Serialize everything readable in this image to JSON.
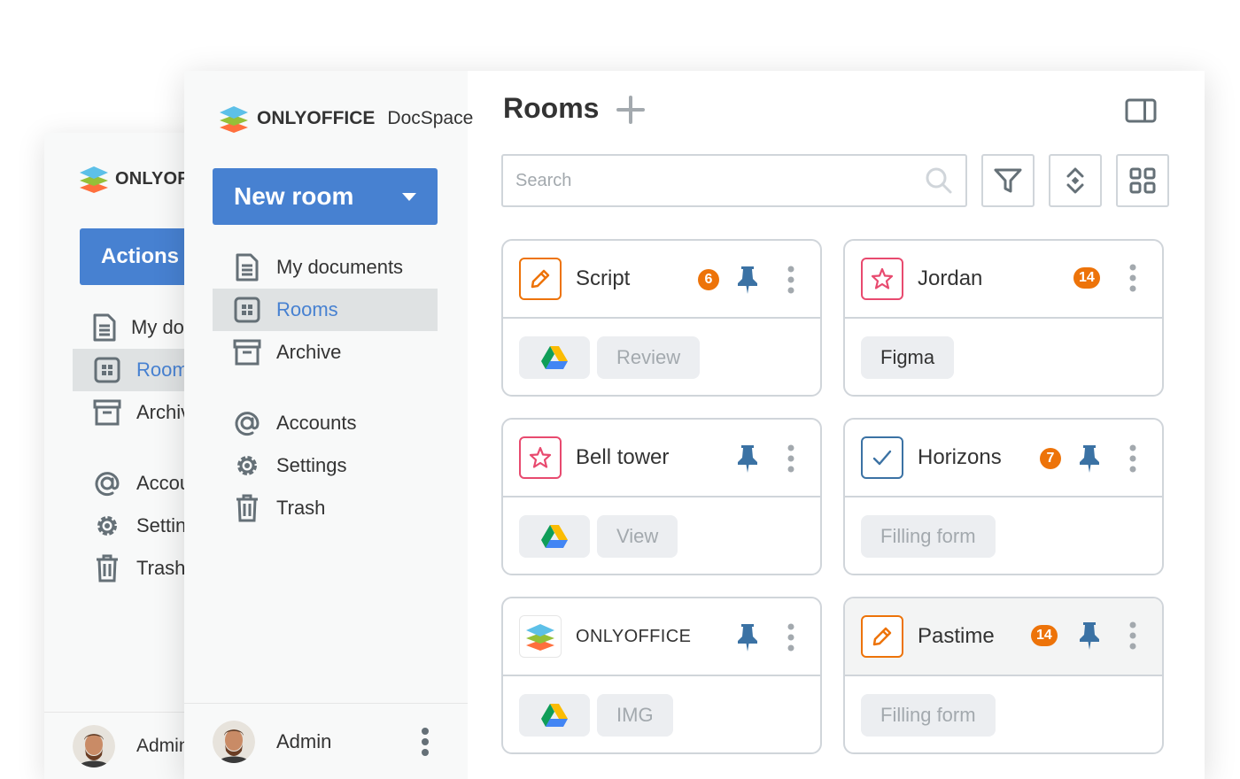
{
  "back_window": {
    "brand": "ONLYOFFICE",
    "actions_label": "Actions",
    "nav": [
      {
        "label": "My documents",
        "icon": "document-icon"
      },
      {
        "label": "Rooms",
        "icon": "rooms-grid-icon",
        "active": true
      },
      {
        "label": "Archive",
        "icon": "archive-icon"
      },
      {
        "label": "Accounts",
        "icon": "at-icon"
      },
      {
        "label": "Settings",
        "icon": "gear-icon"
      },
      {
        "label": "Trash",
        "icon": "trash-icon"
      }
    ],
    "user_name": "Admin"
  },
  "sidebar": {
    "brand_bold": "ONLYOFFICE",
    "brand_light": "DocSpace",
    "new_room_label": "New room",
    "nav": [
      {
        "label": "My documents",
        "icon": "document-icon"
      },
      {
        "label": "Rooms",
        "icon": "rooms-grid-icon",
        "active": true
      },
      {
        "label": "Archive",
        "icon": "archive-icon"
      },
      {
        "label": "Accounts",
        "icon": "at-icon"
      },
      {
        "label": "Settings",
        "icon": "gear-icon"
      },
      {
        "label": "Trash",
        "icon": "trash-icon"
      }
    ],
    "user_name": "Admin"
  },
  "header": {
    "title": "Rooms",
    "search_placeholder": "Search"
  },
  "colors": {
    "accent": "#4781d1",
    "badge": "#ed7309",
    "pin": "#3b72a4",
    "orange_icon": "#ed7309",
    "pink_icon": "#e84a6f",
    "blue_icon": "#3b72a4"
  },
  "rooms": [
    {
      "name": "Script",
      "icon": "pencil-icon",
      "badge": "6",
      "pinned": true,
      "tags": [
        "Review"
      ],
      "drive": true
    },
    {
      "name": "Jordan",
      "icon": "star-icon",
      "badge": "14",
      "pinned": false,
      "tags": [
        "Figma"
      ],
      "drive": false
    },
    {
      "name": "Bell tower",
      "icon": "star-icon",
      "badge": "",
      "pinned": true,
      "tags": [
        "View"
      ],
      "drive": true
    },
    {
      "name": "Horizons",
      "icon": "check-icon",
      "badge": "7",
      "pinned": true,
      "tags": [
        "Filling form"
      ],
      "drive": false
    },
    {
      "name": "ONLYOFFICE",
      "icon": "onlyoffice-logo-icon",
      "badge": "",
      "pinned": true,
      "tags": [
        "IMG"
      ],
      "drive": true
    },
    {
      "name": "Pastime",
      "icon": "pencil-icon",
      "badge": "14",
      "pinned": true,
      "tags": [
        "Filling form"
      ],
      "drive": false
    }
  ]
}
